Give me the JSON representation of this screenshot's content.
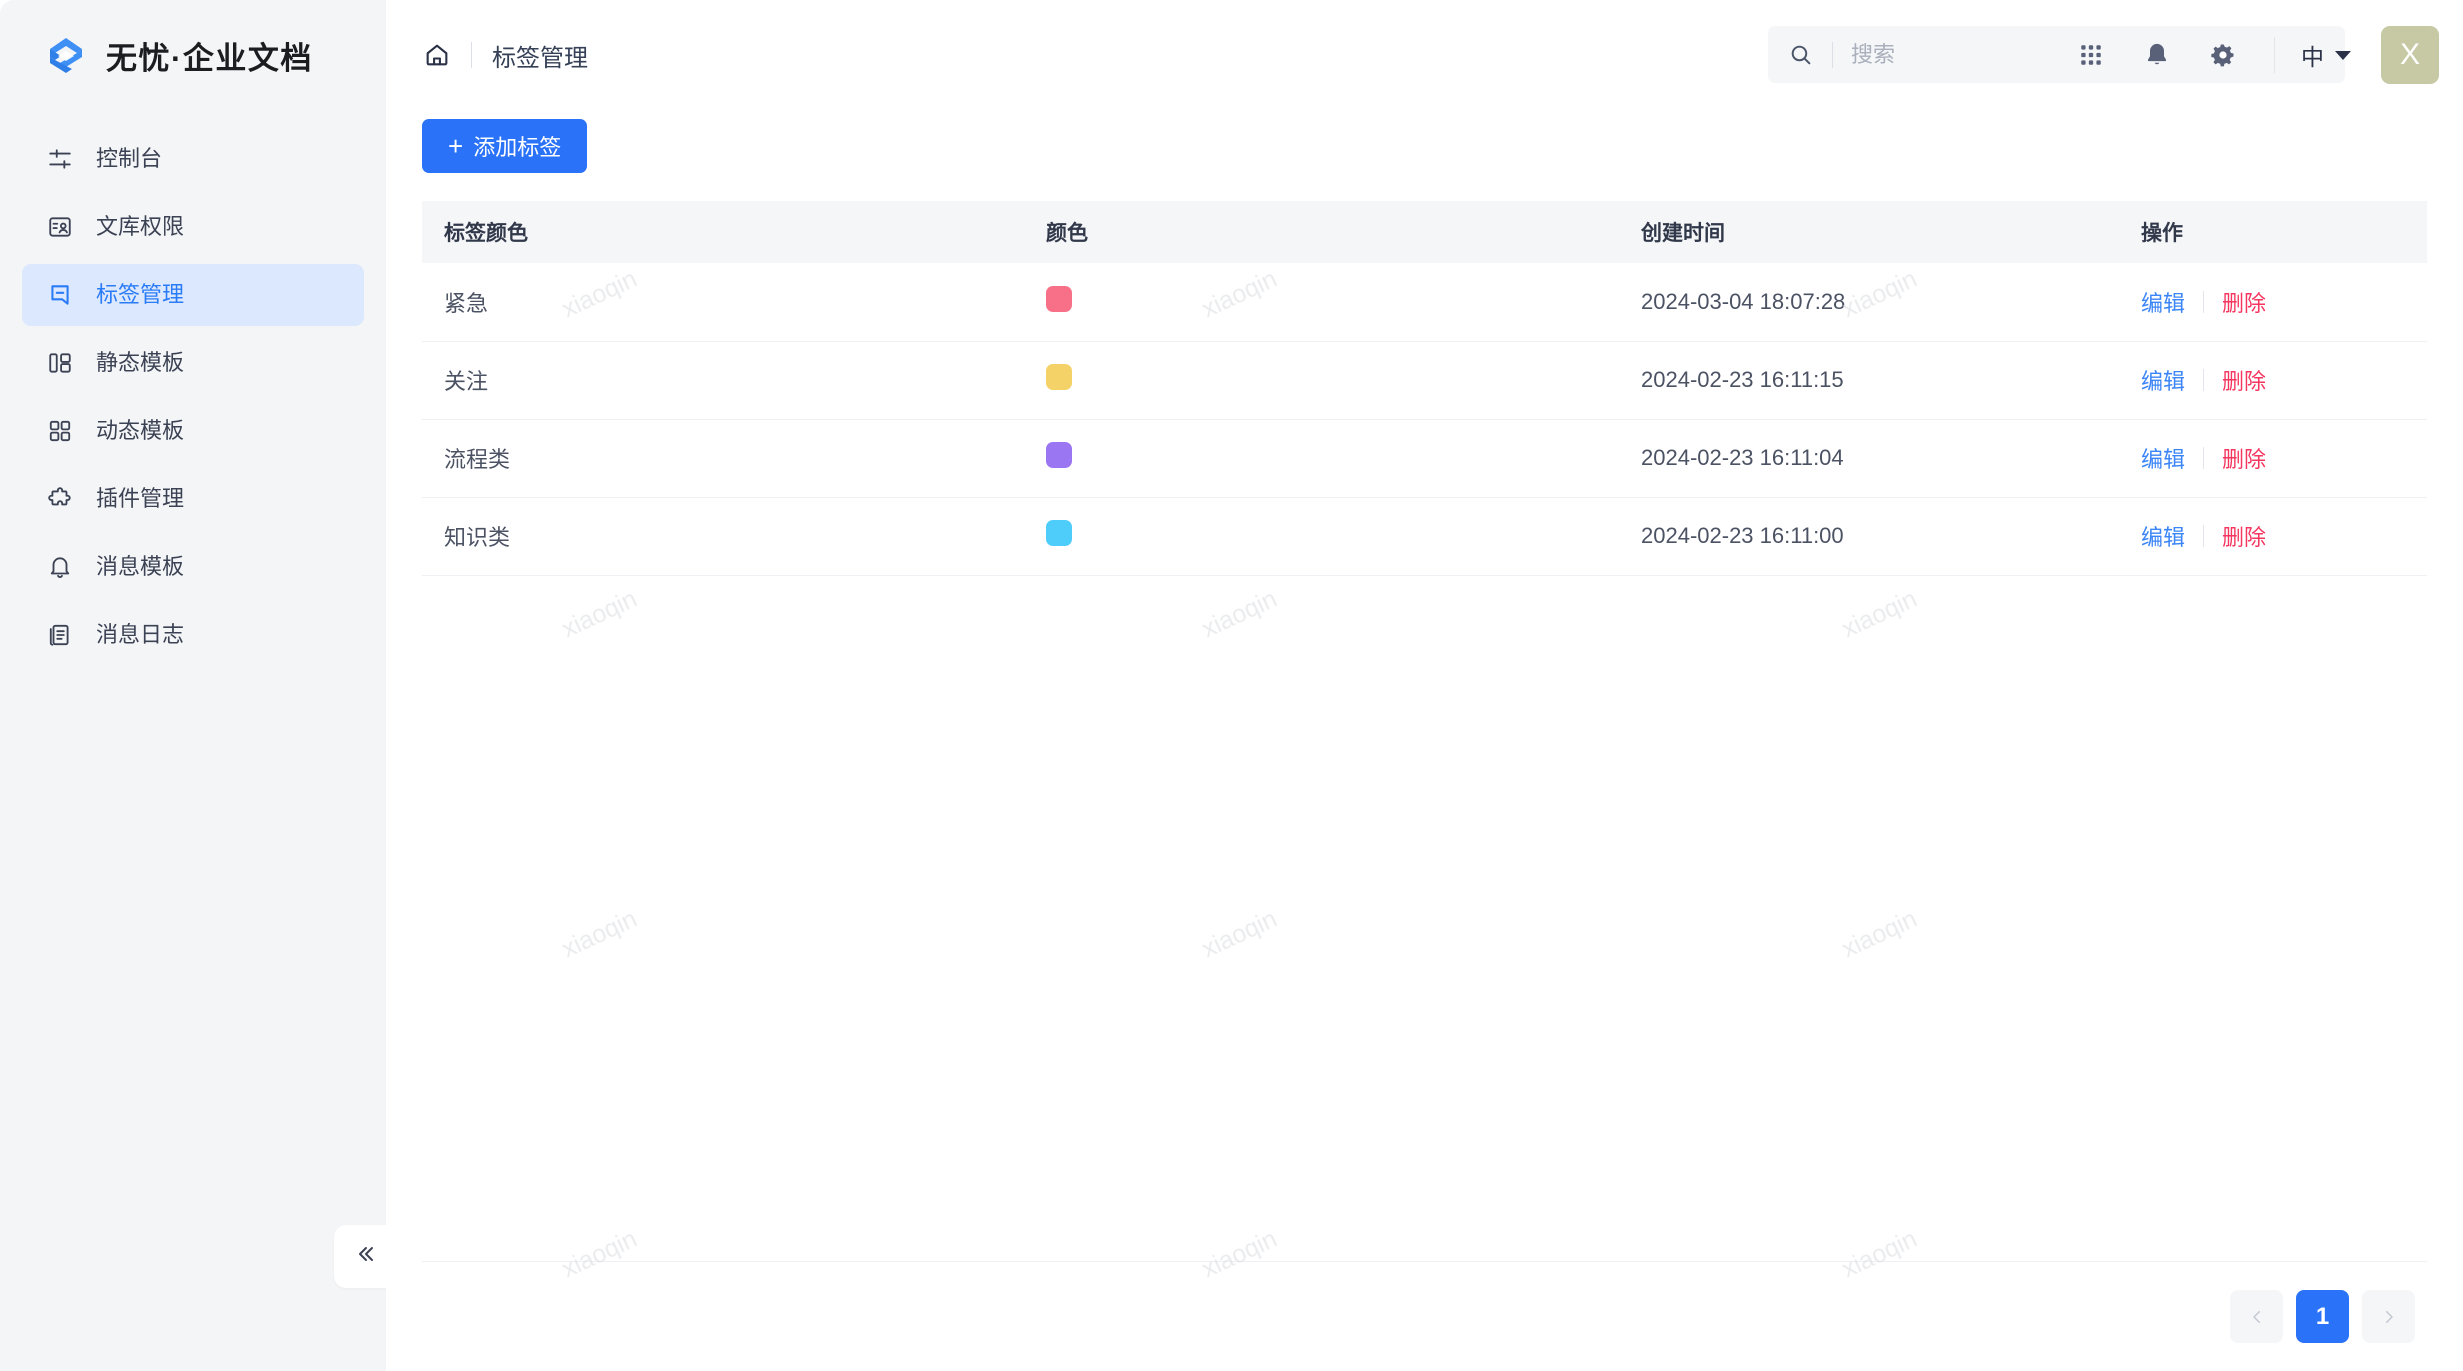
{
  "brand": {
    "title": "无忧·企业文档",
    "logo_icon": "blue-s-logo",
    "logo_color": "#3f90f5"
  },
  "sidebar": {
    "items": [
      {
        "label": "控制台",
        "icon": "sliders-icon",
        "active": false
      },
      {
        "label": "文库权限",
        "icon": "book-user-icon",
        "active": false
      },
      {
        "label": "标签管理",
        "icon": "bookmark-icon",
        "active": true
      },
      {
        "label": "静态模板",
        "icon": "layout-01-icon",
        "active": false
      },
      {
        "label": "动态模板",
        "icon": "grid-four-icon",
        "active": false
      },
      {
        "label": "插件管理",
        "icon": "puzzle-icon",
        "active": false
      },
      {
        "label": "消息模板",
        "icon": "bell-icon",
        "active": false
      },
      {
        "label": "消息日志",
        "icon": "document-icon",
        "active": false
      }
    ],
    "collapse_icon": "double-chevron-left-icon",
    "active_color": "#2a7bf6",
    "active_bg": "#dce8fd"
  },
  "header": {
    "home_icon": "home-icon",
    "breadcrumb_current": "标签管理",
    "search": {
      "icon": "search-icon",
      "placeholder": "搜索",
      "value": ""
    },
    "apps_icon": "grid-apps-icon",
    "bell_icon": "bell-icon",
    "settings_icon": "gear-icon",
    "language": "中",
    "avatar_initial": "X",
    "avatar_color": "#c7c9a4"
  },
  "toolbar": {
    "add_label": "添加标签",
    "add_plus": "+",
    "add_color": "#2a72f8"
  },
  "table": {
    "columns": [
      "标签颜色",
      "颜色",
      "创建时间",
      "操作"
    ],
    "rows": [
      {
        "name": "紧急",
        "color": "#f87088",
        "created": "2024-03-04 18:07:28",
        "edit": "编辑",
        "delete": "删除"
      },
      {
        "name": "关注",
        "color": "#f5d268",
        "created": "2024-02-23 16:11:15",
        "edit": "编辑",
        "delete": "删除"
      },
      {
        "name": "流程类",
        "color": "#9b76f2",
        "created": "2024-02-23 16:11:04",
        "edit": "编辑",
        "delete": "删除"
      },
      {
        "name": "知识类",
        "color": "#4fcdfa",
        "created": "2024-02-23 16:11:00",
        "edit": "编辑",
        "delete": "删除"
      }
    ]
  },
  "pagination": {
    "prev_icon": "chevron-left-icon",
    "next_icon": "chevron-right-icon",
    "pages": [
      "1"
    ],
    "current": "1"
  },
  "watermark": {
    "text": "xiaoqin"
  }
}
